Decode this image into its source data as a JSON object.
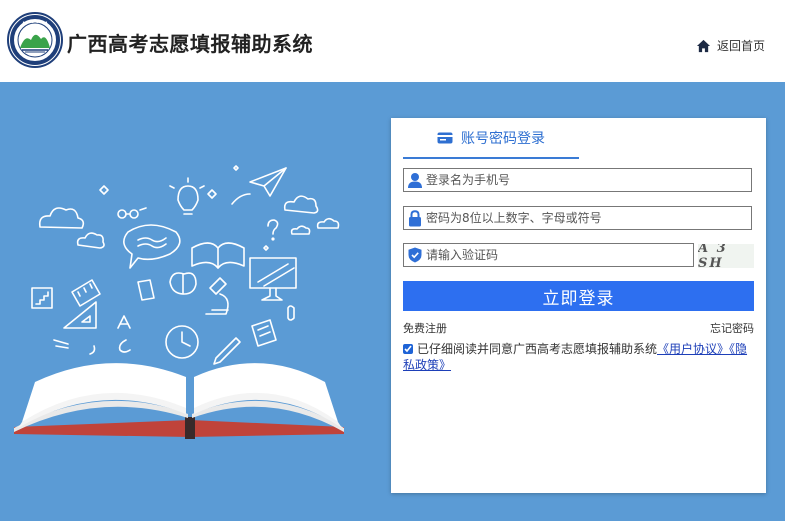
{
  "header": {
    "title": "广西高考志愿填报辅助系统",
    "home_label": "返回首页"
  },
  "login": {
    "tab_label": "账号密码登录",
    "username_placeholder": "登录名为手机号",
    "password_placeholder": "密码为8位以上数字、字母或符号",
    "captcha_placeholder": "请输入验证码",
    "captcha_text": "A 3 SH",
    "submit_label": "立即登录",
    "register_label": "免费注册",
    "forgot_label": "忘记密码",
    "agree_text": "已仔细阅读并同意广西高考志愿填报辅助系统",
    "agree_link_text": "《用户协议》《隐私政策》",
    "agree_checked": true
  },
  "colors": {
    "background": "#5b9bd5",
    "accent": "#2d6ff0",
    "tab_text": "#2e6fd1",
    "link": "#1d3fb8"
  },
  "icons": {
    "logo": "university-seal-logo",
    "home": "home-icon",
    "tab": "id-card-icon",
    "username": "user-icon",
    "password": "lock-icon",
    "captcha": "shield-check-icon"
  }
}
